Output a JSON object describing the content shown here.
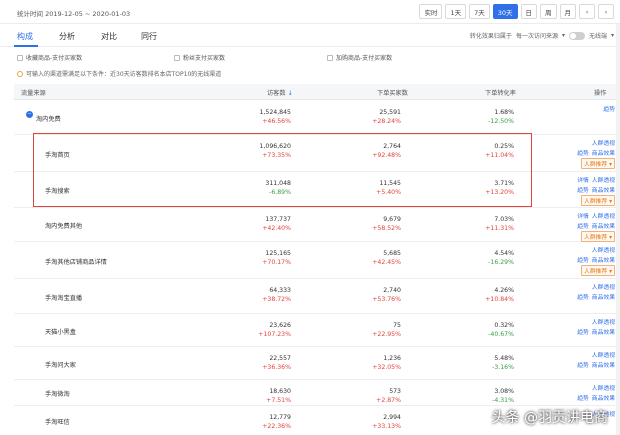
{
  "header": {
    "period": "统计时间 2019-12-05 ~ 2020-01-03",
    "range_buttons": [
      {
        "label": "实时",
        "active": false
      },
      {
        "label": "1天",
        "active": false
      },
      {
        "label": "7天",
        "active": false
      },
      {
        "label": "30天",
        "active": true
      },
      {
        "label": "日",
        "active": false
      },
      {
        "label": "周",
        "active": false
      },
      {
        "label": "月",
        "active": false
      },
      {
        "label": "‹",
        "active": false
      },
      {
        "label": "›",
        "active": false
      }
    ]
  },
  "tabs": [
    "构成",
    "分析",
    "对比",
    "同行"
  ],
  "tools": {
    "attribution_label": "转化效果归属于",
    "attribution_value": "每一次访问来源",
    "wireless_label": "无线端"
  },
  "checkboxes": [
    "收藏商品-支付买家数",
    "粉丝支付买家数",
    "加购商品-支付买家数"
  ],
  "note": "可输入的渠道需满足以下条件：近30天访客数排名本店TOP10的无线渠道",
  "table": {
    "columns": [
      "流量来源",
      "访客数",
      "下单买家数",
      "下单转化率",
      "操作"
    ],
    "rows": [
      {
        "name": "淘内免费",
        "visitors": "1,524,845",
        "visitors_chg": "+46.56%",
        "buyers": "25,591",
        "buyers_chg": "+28.24%",
        "rate": "1.68%",
        "rate_chg": "-12.50%",
        "ops": [
          [
            "趋势"
          ]
        ],
        "expander": "−",
        "indent": false
      },
      {
        "name": "手淘首页",
        "visitors": "1,096,620",
        "visitors_chg": "+73.35%",
        "buyers": "2,764",
        "buyers_chg": "+92.48%",
        "rate": "0.25%",
        "rate_chg": "+11.04%",
        "ops": [
          [
            "人群透视"
          ],
          [
            "趋势",
            "商品效果"
          ]
        ],
        "op_btn": "人群推荐",
        "indent": true
      },
      {
        "name": "手淘搜索",
        "visitors": "311,048",
        "visitors_chg": "-6.89%",
        "buyers": "11,545",
        "buyers_chg": "+5.40%",
        "rate": "3.71%",
        "rate_chg": "+13.20%",
        "ops": [
          [
            "详情",
            "人群透视"
          ],
          [
            "趋势",
            "商品效果"
          ]
        ],
        "op_btn": "人群推荐",
        "indent": true
      },
      {
        "name": "淘内免费其他",
        "visitors": "137,737",
        "visitors_chg": "+42.40%",
        "buyers": "9,679",
        "buyers_chg": "+58.52%",
        "rate": "7.03%",
        "rate_chg": "+11.31%",
        "ops": [
          [
            "详情",
            "人群透视"
          ],
          [
            "趋势",
            "商品效果"
          ]
        ],
        "op_btn": "人群推荐",
        "indent": true
      },
      {
        "name": "手淘其他店铺商品详情",
        "visitors": "125,165",
        "visitors_chg": "+70.17%",
        "buyers": "5,685",
        "buyers_chg": "+42.45%",
        "rate": "4.54%",
        "rate_chg": "-16.29%",
        "ops": [
          [
            "人群透视"
          ],
          [
            "趋势",
            "商品效果"
          ]
        ],
        "op_btn": "人群推荐",
        "indent": true
      },
      {
        "name": "手淘淘宝直播",
        "visitors": "64,333",
        "visitors_chg": "+38.72%",
        "buyers": "2,740",
        "buyers_chg": "+53.76%",
        "rate": "4.26%",
        "rate_chg": "+10.84%",
        "ops": [
          [
            "人群透视"
          ],
          [
            "趋势",
            "商品效果"
          ]
        ],
        "indent": true
      },
      {
        "name": "天猫小黑盒",
        "visitors": "23,626",
        "visitors_chg": "+107.23%",
        "buyers": "75",
        "buyers_chg": "+22.95%",
        "rate": "0.32%",
        "rate_chg": "-40.67%",
        "ops": [
          [
            "人群透视"
          ],
          [
            "趋势",
            "商品效果"
          ]
        ],
        "indent": true
      },
      {
        "name": "手淘问大家",
        "visitors": "22,557",
        "visitors_chg": "+36.36%",
        "buyers": "1,236",
        "buyers_chg": "+32.05%",
        "rate": "5.48%",
        "rate_chg": "-3.16%",
        "ops": [
          [
            "人群透视"
          ],
          [
            "趋势",
            "商品效果"
          ]
        ],
        "indent": true
      },
      {
        "name": "手淘微淘",
        "visitors": "18,630",
        "visitors_chg": "+7.51%",
        "buyers": "573",
        "buyers_chg": "+2.87%",
        "rate": "3.08%",
        "rate_chg": "-4.31%",
        "ops": [
          [
            "人群透视"
          ],
          [
            "趋势",
            "商品效果"
          ]
        ],
        "indent": true
      },
      {
        "name": "手淘旺信",
        "visitors": "12,779",
        "visitors_chg": "+22.36%",
        "buyers": "2,994",
        "buyers_chg": "+33.13%",
        "rate": "",
        "rate_chg": "",
        "ops": [
          [
            "人群透视"
          ]
        ],
        "indent": true
      }
    ]
  },
  "watermark": "头条 @羽贡讲电商",
  "colors": {
    "accent": "#2f6fe8",
    "up": "#e0443d",
    "down": "#38a048",
    "highlight": "#e0443d"
  }
}
